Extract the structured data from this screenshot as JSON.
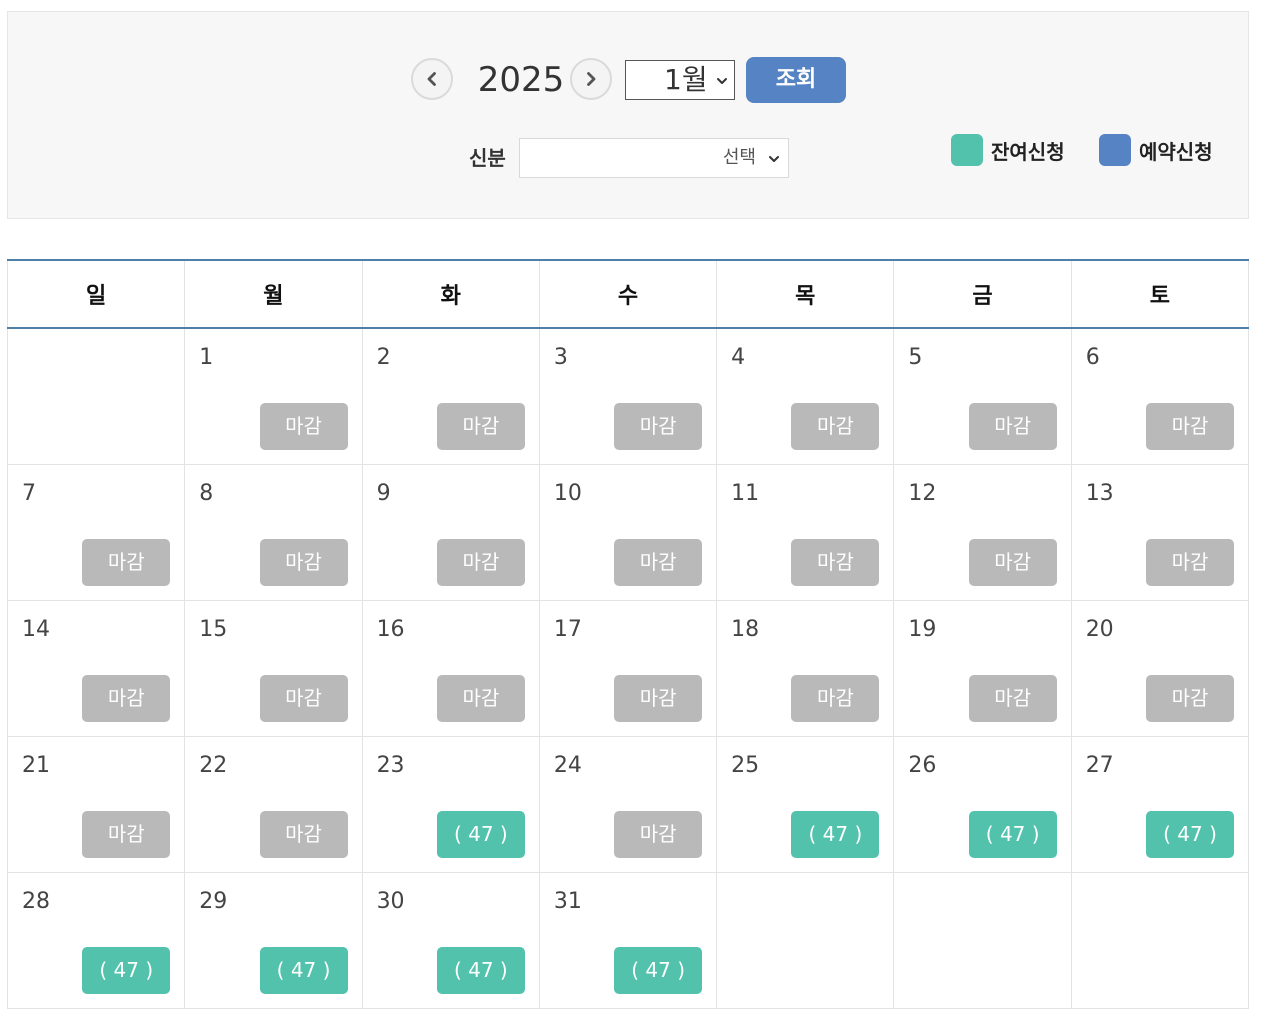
{
  "header": {
    "year": "2025",
    "month_selected": "1월",
    "search_label": "조회",
    "status_label": "신분",
    "status_selected": "선택"
  },
  "legend": [
    {
      "label": "잔여신청",
      "color": "#52c2ac"
    },
    {
      "label": "예약신청",
      "color": "#5683c4"
    }
  ],
  "colors": {
    "accent": "#5683c4",
    "open": "#52c2ac",
    "closed": "#b9b9b9",
    "header_line": "#4e7fa8"
  },
  "calendar": {
    "weekdays": [
      "일",
      "월",
      "화",
      "수",
      "목",
      "금",
      "토"
    ],
    "weeks": [
      [
        null,
        {
          "day": "1",
          "slot": "마감",
          "open": false
        },
        {
          "day": "2",
          "slot": "마감",
          "open": false
        },
        {
          "day": "3",
          "slot": "마감",
          "open": false
        },
        {
          "day": "4",
          "slot": "마감",
          "open": false
        },
        {
          "day": "5",
          "slot": "마감",
          "open": false
        },
        {
          "day": "6",
          "slot": "마감",
          "open": false
        }
      ],
      [
        {
          "day": "7",
          "slot": "마감",
          "open": false
        },
        {
          "day": "8",
          "slot": "마감",
          "open": false
        },
        {
          "day": "9",
          "slot": "마감",
          "open": false
        },
        {
          "day": "10",
          "slot": "마감",
          "open": false
        },
        {
          "day": "11",
          "slot": "마감",
          "open": false
        },
        {
          "day": "12",
          "slot": "마감",
          "open": false
        },
        {
          "day": "13",
          "slot": "마감",
          "open": false
        }
      ],
      [
        {
          "day": "14",
          "slot": "마감",
          "open": false
        },
        {
          "day": "15",
          "slot": "마감",
          "open": false
        },
        {
          "day": "16",
          "slot": "마감",
          "open": false
        },
        {
          "day": "17",
          "slot": "마감",
          "open": false
        },
        {
          "day": "18",
          "slot": "마감",
          "open": false
        },
        {
          "day": "19",
          "slot": "마감",
          "open": false
        },
        {
          "day": "20",
          "slot": "마감",
          "open": false
        }
      ],
      [
        {
          "day": "21",
          "slot": "마감",
          "open": false
        },
        {
          "day": "22",
          "slot": "마감",
          "open": false
        },
        {
          "day": "23",
          "slot": "( 47 )",
          "open": true
        },
        {
          "day": "24",
          "slot": "마감",
          "open": false
        },
        {
          "day": "25",
          "slot": "( 47 )",
          "open": true
        },
        {
          "day": "26",
          "slot": "( 47 )",
          "open": true
        },
        {
          "day": "27",
          "slot": "( 47 )",
          "open": true
        }
      ],
      [
        {
          "day": "28",
          "slot": "( 47 )",
          "open": true
        },
        {
          "day": "29",
          "slot": "( 47 )",
          "open": true
        },
        {
          "day": "30",
          "slot": "( 47 )",
          "open": true
        },
        {
          "day": "31",
          "slot": "( 47 )",
          "open": true
        },
        null,
        null,
        null
      ]
    ]
  }
}
